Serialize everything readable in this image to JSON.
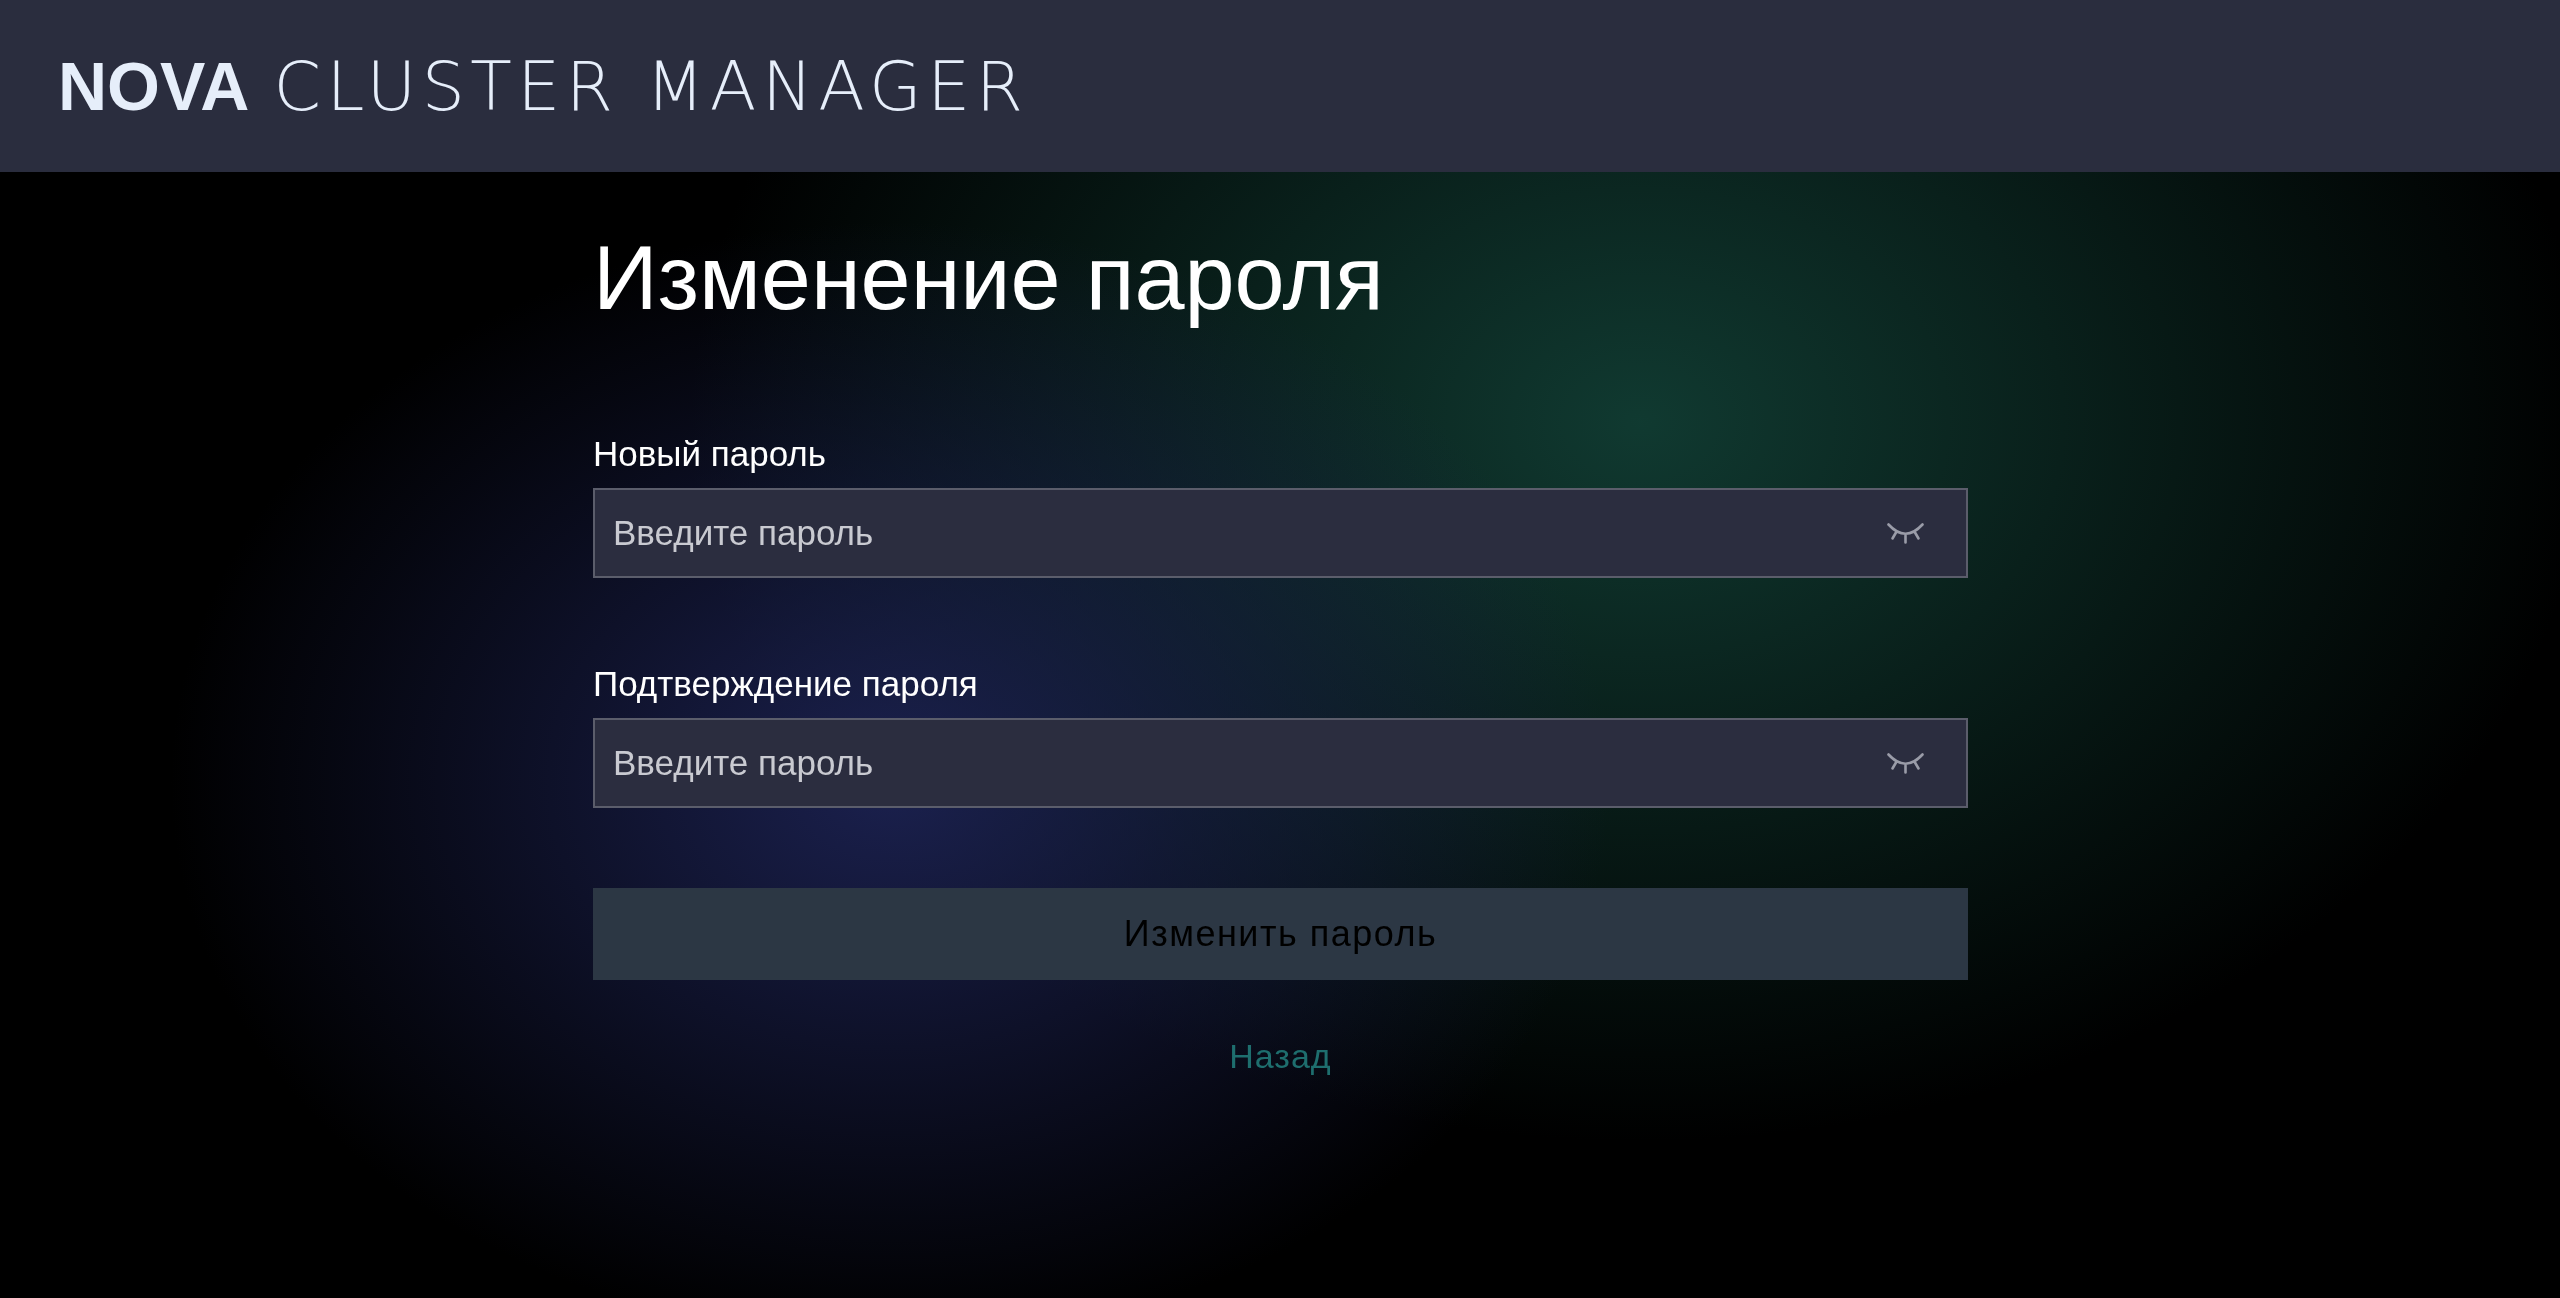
{
  "header": {
    "logo": {
      "brand": "NOVA",
      "product": "CLUSTER MANAGER"
    }
  },
  "page": {
    "title": "Изменение пароля"
  },
  "form": {
    "fields": [
      {
        "label": "Новый пароль",
        "placeholder": "Введите пароль",
        "password_visible": false
      },
      {
        "label": "Подтверждение пароля",
        "placeholder": "Введите пароль",
        "password_visible": false
      }
    ]
  },
  "submit_button": {
    "label": "Изменить пароль",
    "disabled": true
  },
  "back_link": {
    "label": "Назад"
  }
}
